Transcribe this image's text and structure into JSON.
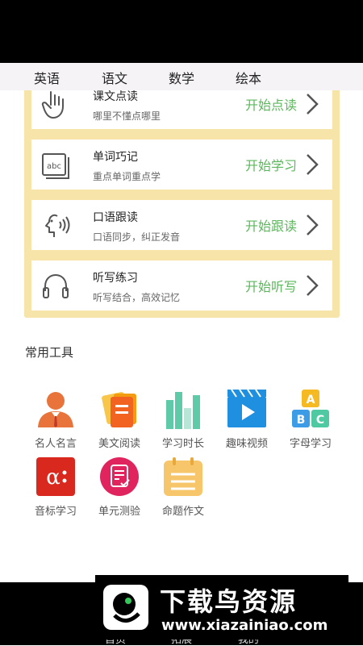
{
  "tabs": [
    "英语",
    "语文",
    "数学",
    "绘本"
  ],
  "cards": [
    {
      "title": "课文点读",
      "subtitle": "哪里不懂点哪里",
      "action": "开始点读",
      "icon": "hand-touch-icon"
    },
    {
      "title": "单词巧记",
      "subtitle": "重点单词重点学",
      "action": "开始学习",
      "icon": "abc-card-icon"
    },
    {
      "title": "口语跟读",
      "subtitle": "口语同步，纠正发音",
      "action": "开始跟读",
      "icon": "speaking-head-icon"
    },
    {
      "title": "听写练习",
      "subtitle": "听写结合，高效记忆",
      "action": "开始听写",
      "icon": "headphones-icon"
    }
  ],
  "tools_section": {
    "title": "常用工具"
  },
  "tools": [
    {
      "label": "名人名言",
      "icon": "person-icon"
    },
    {
      "label": "美文阅读",
      "icon": "book-pages-icon"
    },
    {
      "label": "学习时长",
      "icon": "bar-chart-icon"
    },
    {
      "label": "趣味视频",
      "icon": "video-clapper-icon"
    },
    {
      "label": "字母学习",
      "icon": "abc-blocks-icon"
    },
    {
      "label": "音标学习",
      "icon": "phonetic-alpha-icon"
    },
    {
      "label": "单元测验",
      "icon": "test-paper-icon"
    },
    {
      "label": "命题作文",
      "icon": "calendar-note-icon"
    }
  ],
  "bottom_nav": [
    "首页",
    "拓展",
    "我的"
  ],
  "watermark": {
    "brand": "下载鸟资源",
    "url": "www.xiazainiao.com"
  },
  "colors": {
    "action": "#5cb85c",
    "panel": "#f6e4a9",
    "tab_bg": "#f5f3f6"
  }
}
